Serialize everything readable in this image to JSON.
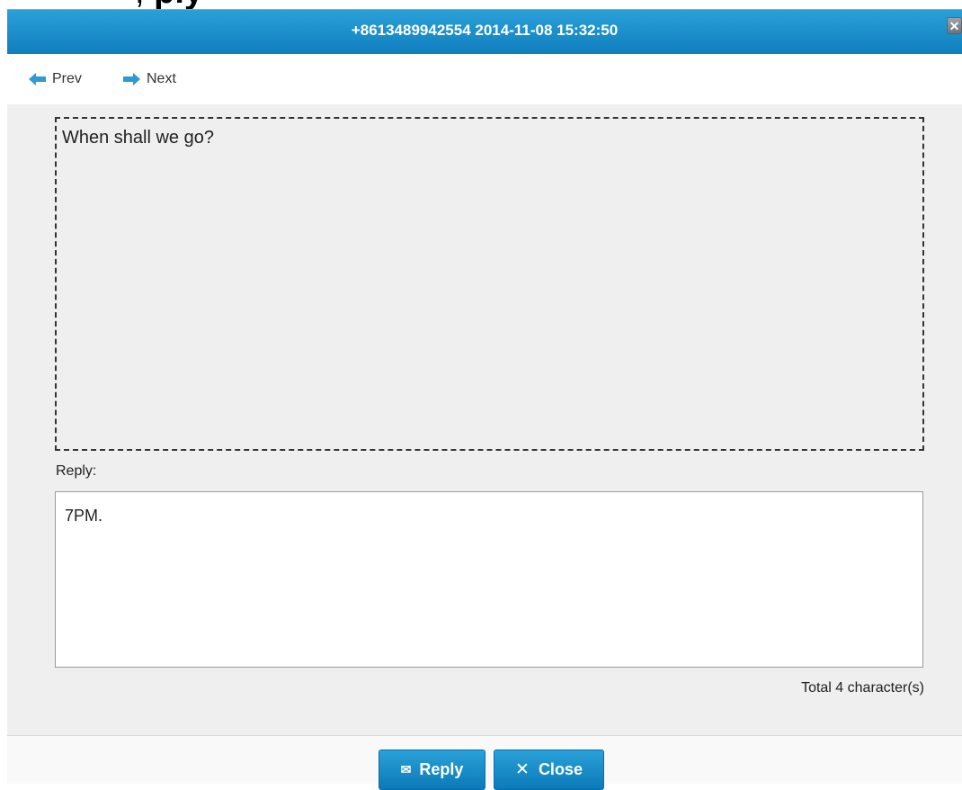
{
  "background_strip": {
    "text_bold": "ply",
    "text_rest": "rrrrrrrrplyrrrr"
  },
  "dialog": {
    "title": "+8613489942554 2014-11-08 15:32:50",
    "close_glyph": "✕"
  },
  "nav": {
    "prev_label": "Prev",
    "next_label": "Next"
  },
  "message": {
    "text": "When shall we go?"
  },
  "reply": {
    "label": "Reply:",
    "value": "7PM.",
    "char_count": "Total 4 character(s)"
  },
  "footer": {
    "reply_button": "Reply",
    "close_button": "Close"
  },
  "colors": {
    "accent": "#1b8fcc",
    "arrow": "#2b9ad6"
  },
  "icons": {
    "prev": "arrow-left-icon",
    "next": "arrow-right-icon",
    "reply": "envelope-icon",
    "close": "close-icon"
  }
}
